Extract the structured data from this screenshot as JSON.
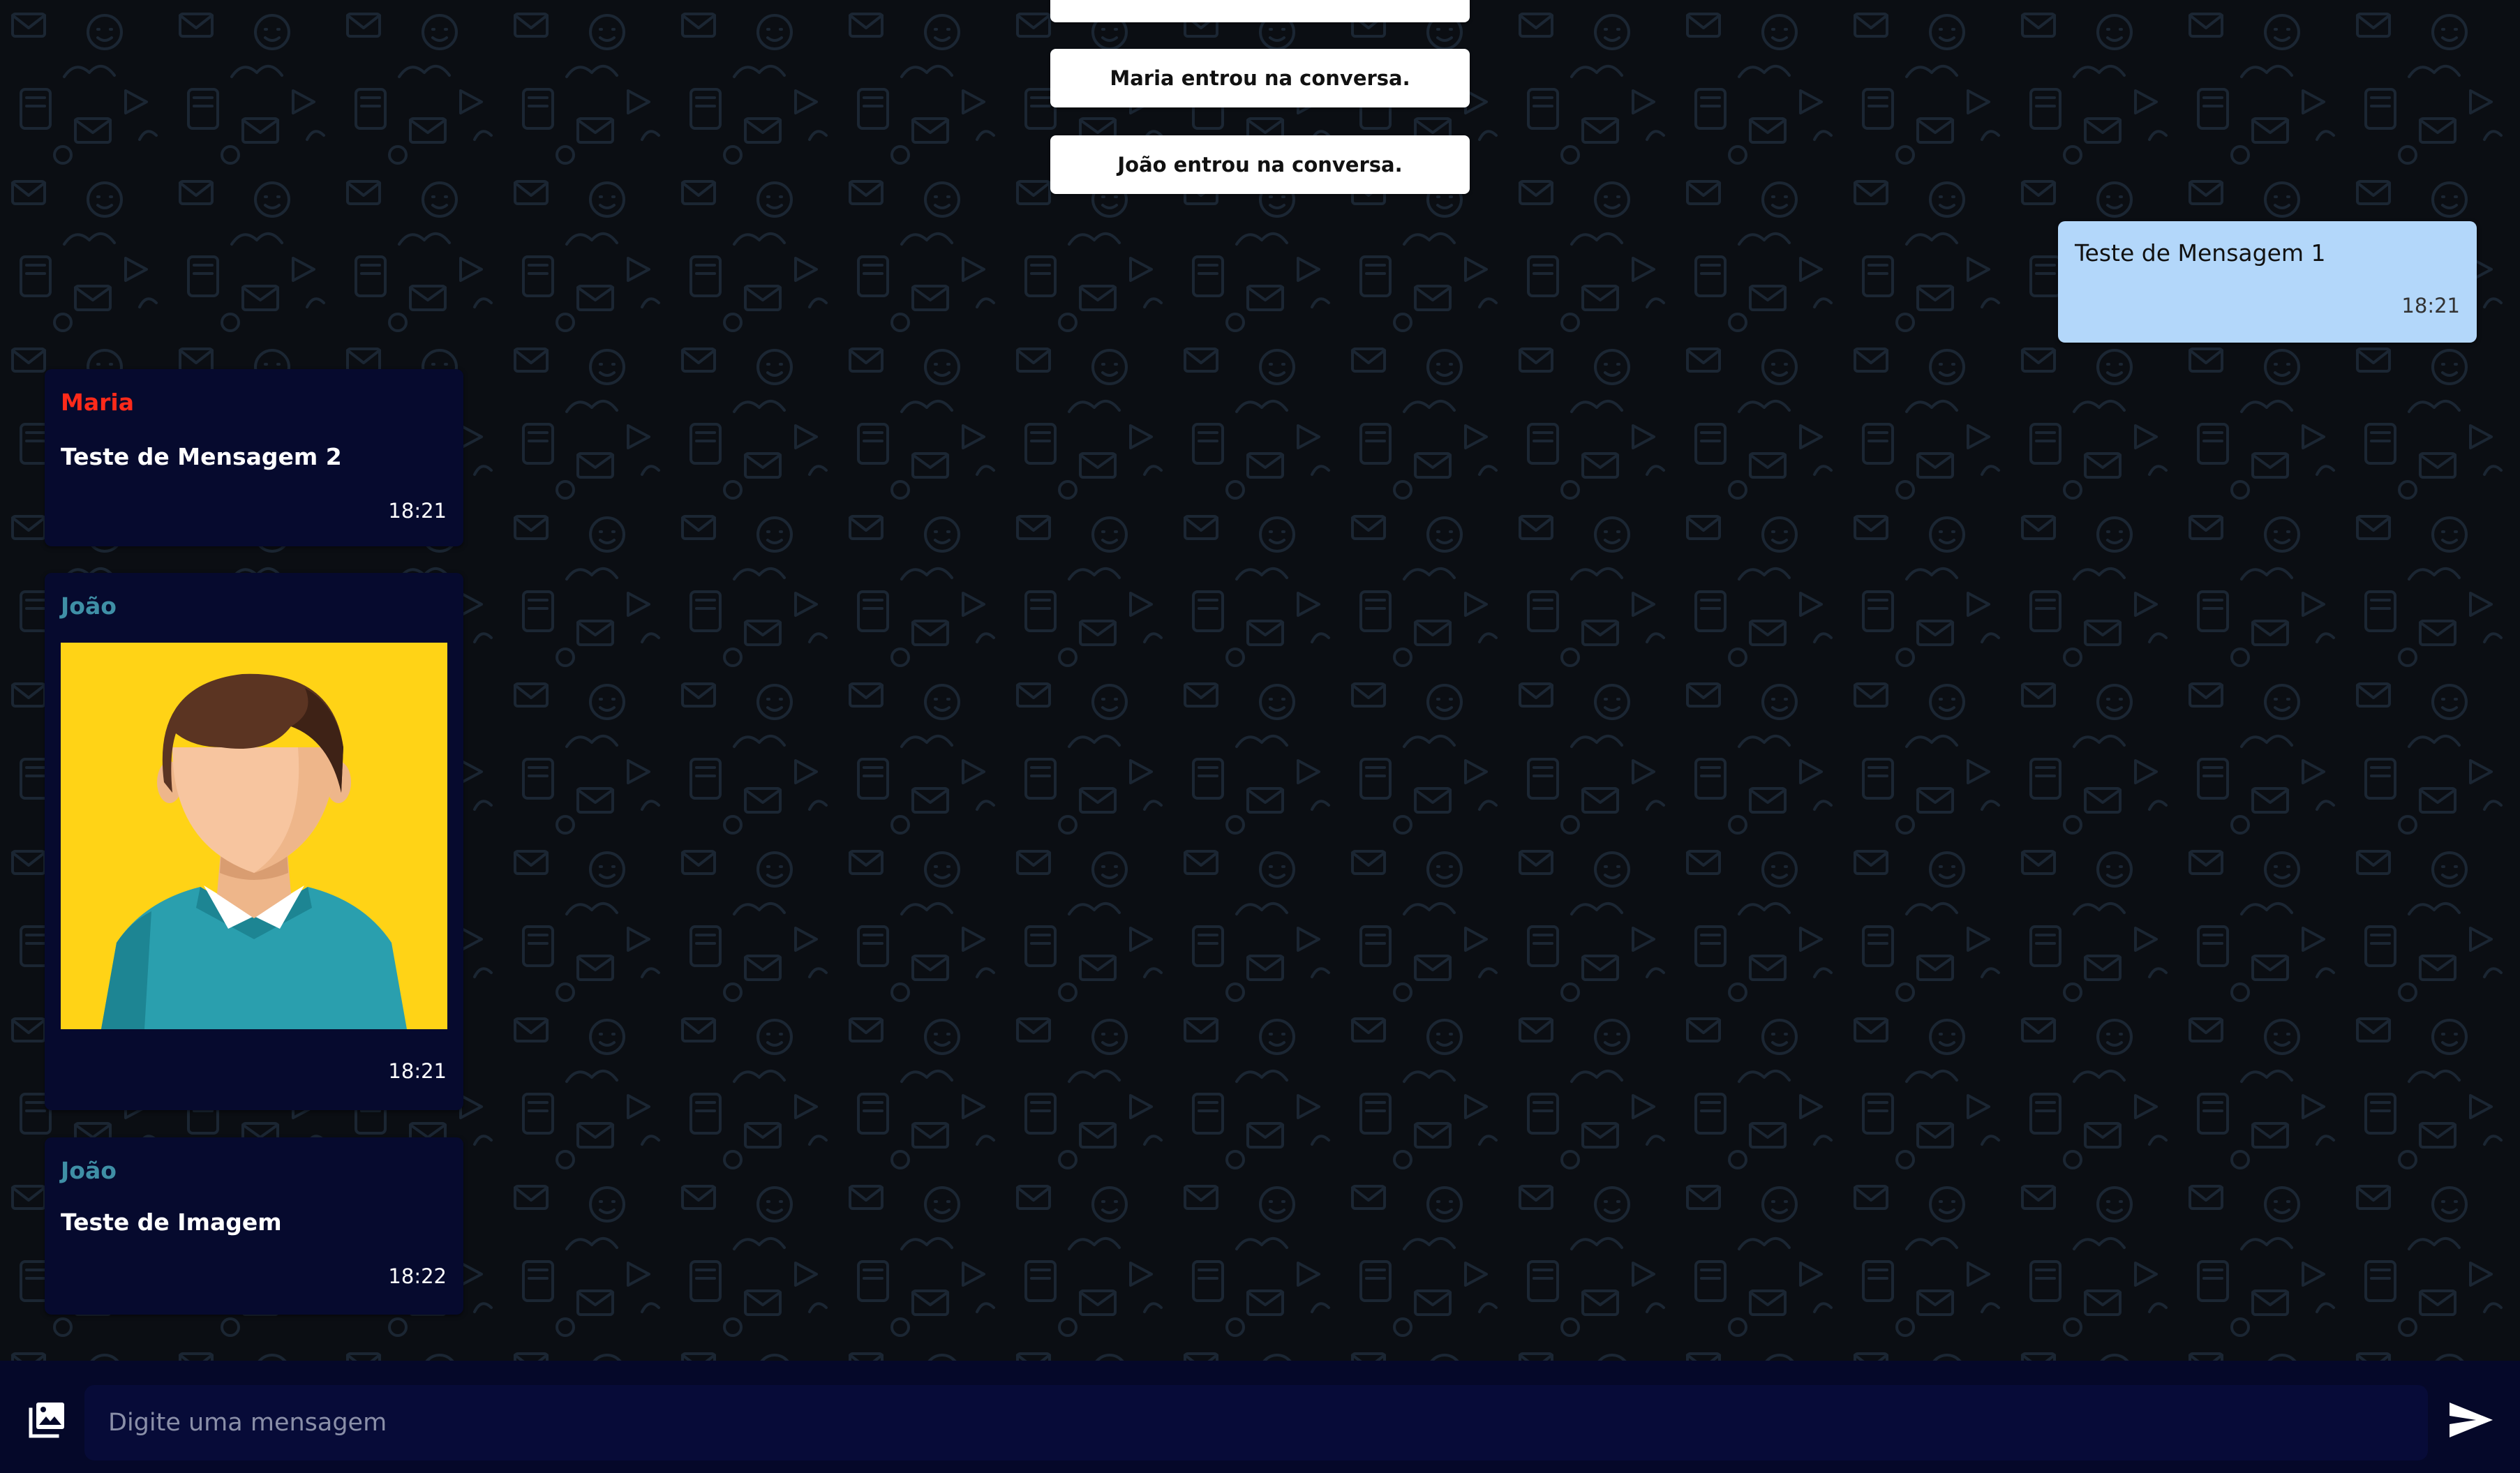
{
  "system_messages": [
    {
      "text": "Maria entrou na conversa."
    },
    {
      "text": "João entrou na conversa."
    }
  ],
  "outgoing_message": {
    "text": "Teste de Mensagem 1",
    "time": "18:21"
  },
  "incoming_messages": [
    {
      "sender": "Maria",
      "sender_color": "#ff2a1a",
      "text": "Teste de Mensagem 2",
      "time": "18:21"
    },
    {
      "sender": "João",
      "sender_color": "#3f8fa6",
      "image": "person-avatar-image",
      "time": "18:21"
    },
    {
      "sender": "João",
      "sender_color": "#3f8fa6",
      "text": "Teste de Imagem",
      "time": "18:22"
    }
  ],
  "composer": {
    "placeholder": "Digite uma mensagem",
    "attach_icon": "image-gallery-icon",
    "send_icon": "send-arrow-icon"
  },
  "colors": {
    "background": "#0b0e13",
    "incoming_bubble": "#060a2e",
    "outgoing_bubble": "#b3d7fa",
    "footer": "#050829",
    "avatar_background": "#ffd316"
  }
}
